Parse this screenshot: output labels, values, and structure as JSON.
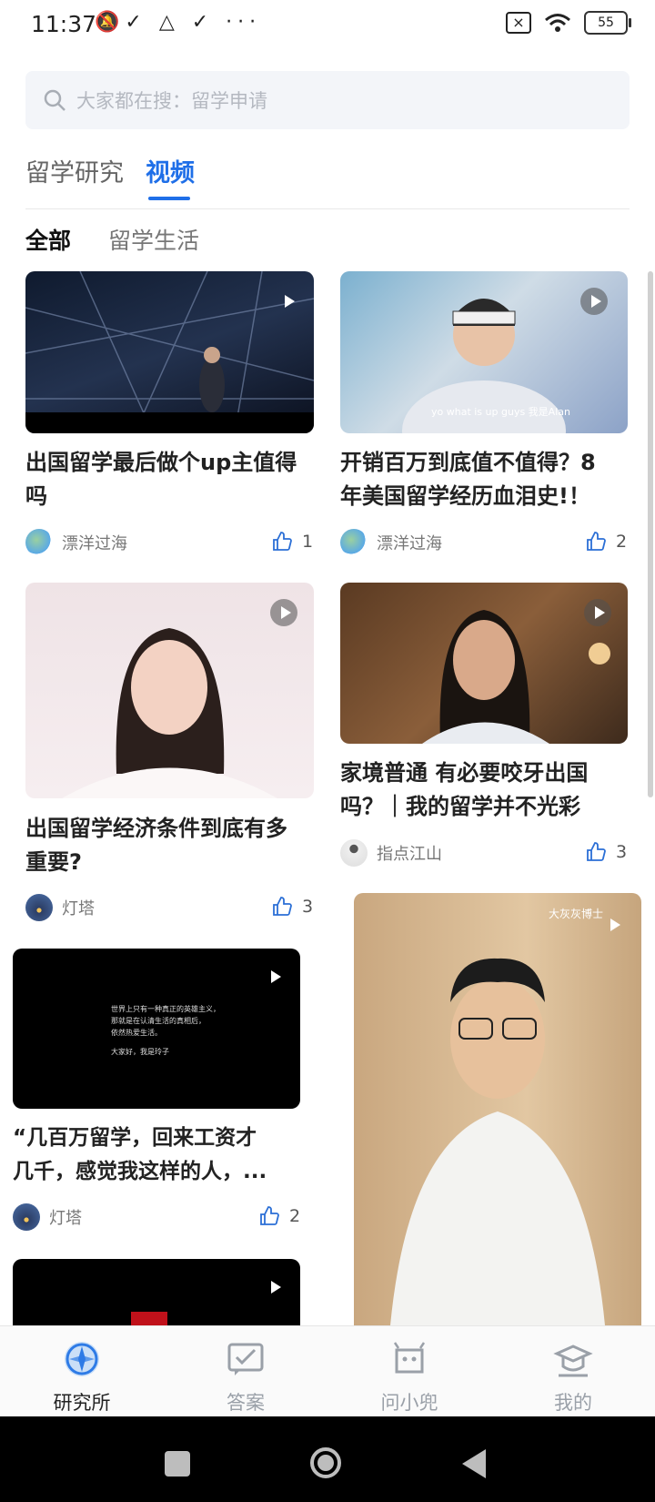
{
  "status": {
    "time": "11:37",
    "left_icons": "✓ △ ✓ ···",
    "battery": "55"
  },
  "search": {
    "placeholder": "大家都在搜：留学申请"
  },
  "tabs": [
    {
      "label": "留学研究",
      "active": false
    },
    {
      "label": "视频",
      "active": true
    }
  ],
  "subtabs": [
    {
      "label": "全部",
      "active": true
    },
    {
      "label": "留学生活",
      "active": false
    }
  ],
  "cards": [
    {
      "title_line1": "出国留学最后做个up主值得",
      "title_line2": "吗",
      "author": "漂洋过海",
      "likes": "1"
    },
    {
      "title_line1": "开销百万到底值不值得？8",
      "title_line2": "年美国留学经历血泪史!！",
      "author": "漂洋过海",
      "likes": "2",
      "caption": "yo what is up guys 我是Alan"
    },
    {
      "title_line1": "出国留学经济条件到底有多",
      "title_line2": "重要?",
      "author": "灯塔",
      "likes": "3"
    },
    {
      "title_line1": "家境普通 有必要咬牙出国",
      "title_line2": "吗？｜我的留学并不光彩",
      "author": "指点江山",
      "likes": "3"
    },
    {
      "title_line1": "“几百万留学，回来工资才",
      "title_line2": "几千，感觉我这样的人，...",
      "author": "灯塔",
      "likes": "2",
      "video_text_1": "世界上只有一种真正的英雄主义，",
      "video_text_2": "那就是在认清生活的真相后，",
      "video_text_3": "依然热爱生活。",
      "video_text_4": "大家好，我是玲子"
    },
    {
      "watermark": "大灰灰博士"
    }
  ],
  "bottom_nav": [
    {
      "label": "研究所",
      "icon": "compass-icon",
      "active": true
    },
    {
      "label": "答案",
      "icon": "message-check-icon",
      "active": false
    },
    {
      "label": "问小兜",
      "icon": "robot-chat-icon",
      "active": false
    },
    {
      "label": "我的",
      "icon": "graduation-cap-icon",
      "active": false
    }
  ],
  "colors": {
    "accent": "#1f6fe8",
    "search_bg": "#f3f5f9"
  }
}
